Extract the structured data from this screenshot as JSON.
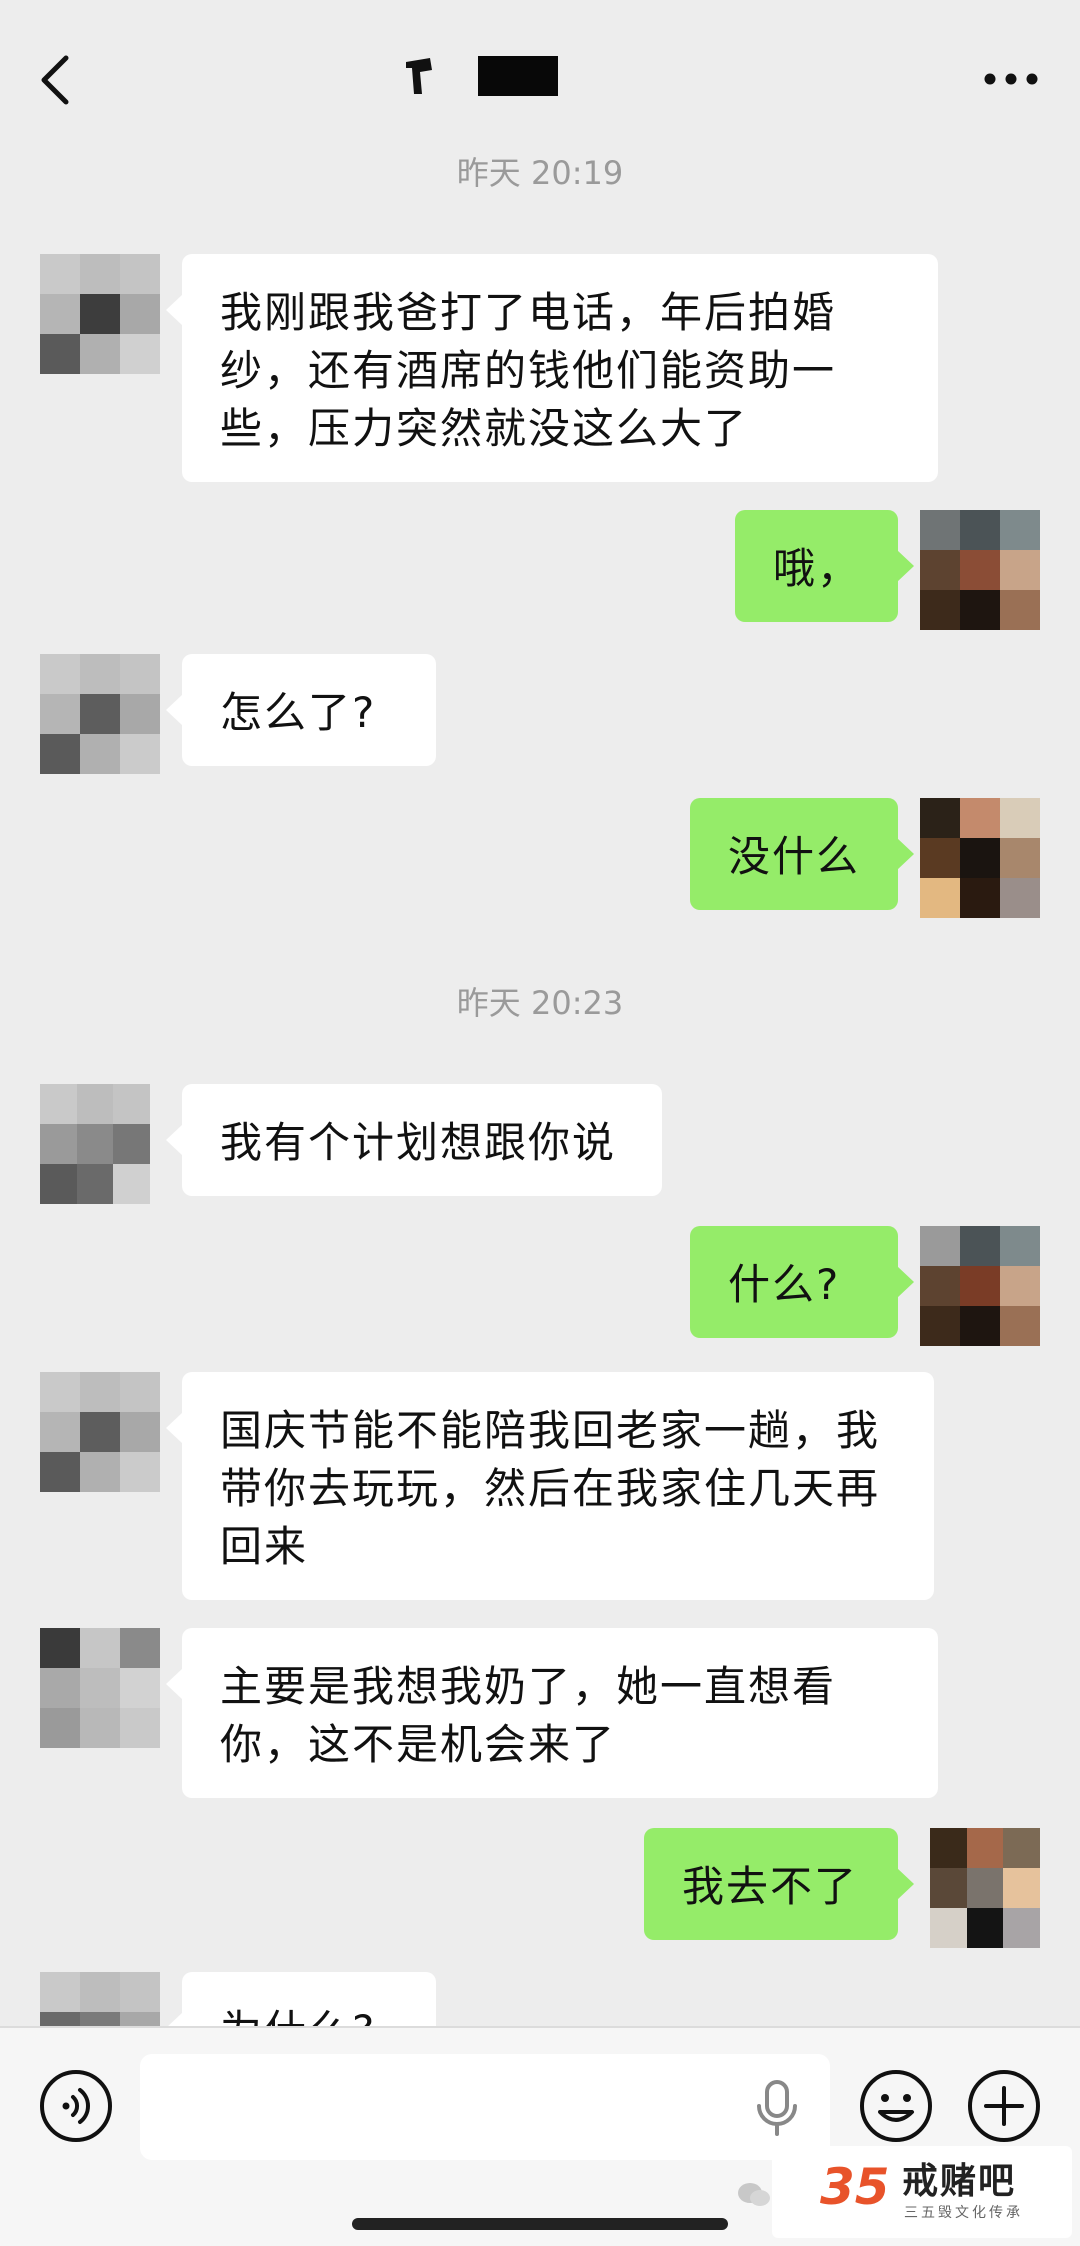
{
  "header": {
    "back_icon": "chevron-left-icon",
    "more_icon": "more-horizontal-icon"
  },
  "chat": {
    "timestamps": [
      "昨天 20:19",
      "昨天 20:23"
    ],
    "messages": [
      {
        "side": "left",
        "text": "我刚跟我爸打了电话，年后拍婚纱，还有酒席的钱他们能资助一些，压力突然就没这么大了"
      },
      {
        "side": "right",
        "text": "哦，"
      },
      {
        "side": "left",
        "text": "怎么了?"
      },
      {
        "side": "right",
        "text": "没什么"
      },
      {
        "side": "left",
        "text": "我有个计划想跟你说"
      },
      {
        "side": "right",
        "text": "什么?"
      },
      {
        "side": "left",
        "text": "国庆节能不能陪我回老家一趟，我带你去玩玩，然后在我家住几天再回来"
      },
      {
        "side": "left",
        "text": "主要是我想我奶了，她一直想看你，这不是机会来了"
      },
      {
        "side": "right",
        "text": "我去不了"
      },
      {
        "side": "left",
        "text": "为什么?"
      }
    ]
  },
  "input_bar": {
    "voice_icon": "voice-icon",
    "mic_icon": "microphone-icon",
    "emoji_icon": "emoji-icon",
    "plus_icon": "plus-icon"
  },
  "watermark": {
    "logo_text": "35",
    "name": "戒赌吧",
    "subtitle": "三五毁文化传承"
  },
  "colors": {
    "background": "#ededed",
    "bubble_self": "#95ec69",
    "bubble_other": "#ffffff",
    "timestamp": "#9a9a9a"
  }
}
